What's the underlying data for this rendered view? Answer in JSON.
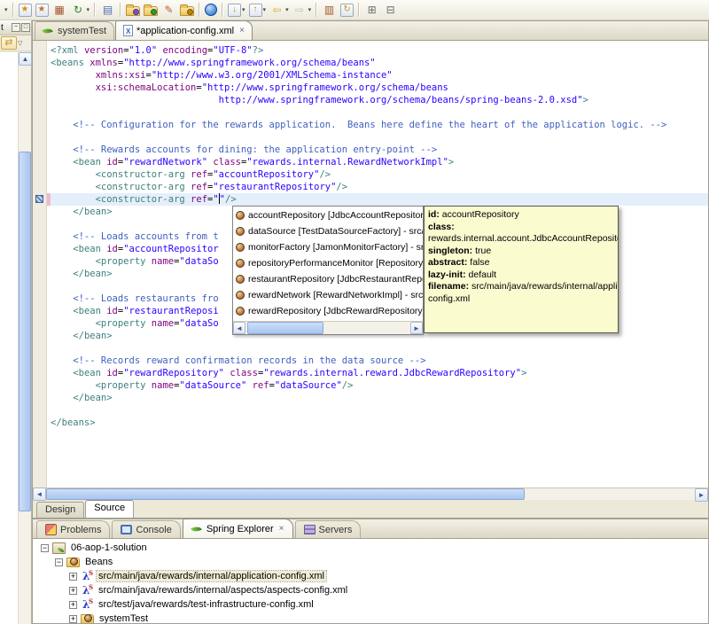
{
  "toolbar": {
    "items": [
      {
        "name": "toolbar-overflow-chevron",
        "kind": "caret-only"
      },
      {
        "sep": true
      },
      {
        "name": "new-wizard-icon",
        "kind": "boxglyph",
        "glyph": "★",
        "fg": "#d89010"
      },
      {
        "name": "new-wizard-alt-icon",
        "kind": "boxglyph",
        "glyph": "★",
        "fg": "#c87020"
      },
      {
        "name": "package-grid-icon",
        "kind": "glyph",
        "glyph": "▦",
        "fg": "#a0522d"
      },
      {
        "name": "refresh-icon",
        "kind": "glyph",
        "glyph": "↻",
        "fg": "#1f8a1f",
        "caret": true
      },
      {
        "sep": true
      },
      {
        "name": "table-wizard-icon",
        "kind": "glyph",
        "glyph": "▤",
        "fg": "#4f6fae"
      },
      {
        "sep": true
      },
      {
        "name": "import-folder-icon",
        "kind": "folder",
        "dot": "#7a4fd0"
      },
      {
        "name": "export-folder-icon",
        "kind": "folder",
        "dot": "#2e9a2e"
      },
      {
        "name": "highlighter-pen-icon",
        "kind": "glyph",
        "glyph": "✎",
        "fg": "#c06030"
      },
      {
        "name": "open-folder-icon",
        "kind": "folder",
        "dot": "#b8860b"
      },
      {
        "sep": true
      },
      {
        "name": "web-browser-icon",
        "kind": "globe"
      },
      {
        "sep": true
      },
      {
        "name": "import-config-icon",
        "kind": "boxglyph",
        "glyph": "↓",
        "fg": "#c89018",
        "caret": true
      },
      {
        "name": "export-config-icon",
        "kind": "boxglyph",
        "glyph": "↑",
        "fg": "#c89018",
        "caret": true
      },
      {
        "name": "back-arrow-icon",
        "kind": "glyph",
        "glyph": "⇦",
        "fg": "#d9a62e",
        "caret": true
      },
      {
        "name": "forward-arrow-icon",
        "kind": "glyph",
        "glyph": "⇨",
        "fg": "#c4c0ae",
        "caret": true
      },
      {
        "sep": true
      },
      {
        "name": "spool-icon",
        "kind": "glyph",
        "glyph": "▥",
        "fg": "#a0522d"
      },
      {
        "name": "refresh-config-icon",
        "kind": "boxglyph",
        "glyph": "↻",
        "fg": "#c89018"
      },
      {
        "sep": true
      },
      {
        "name": "expand-all-icon",
        "kind": "glyph",
        "glyph": "⊞",
        "fg": "#6a6a6a"
      },
      {
        "name": "collapse-all-icon",
        "kind": "glyph",
        "glyph": "⊟",
        "fg": "#6a6a6a"
      }
    ]
  },
  "left_rail": {
    "header_text": "t",
    "minimize_glyph": "−",
    "maximize_glyph": "□",
    "link_glyph": "⇄",
    "dropdown_glyph": "▽",
    "scroll_up_glyph": "▲"
  },
  "editor": {
    "tabs": [
      {
        "name": "tab-systemtest",
        "label": "systemTest",
        "icon": "spring-leaf-icon",
        "selected": false,
        "closable": false
      },
      {
        "name": "tab-application-config",
        "label": "*application-config.xml",
        "icon": "xml-file-icon",
        "selected": true,
        "closable": true,
        "close_glyph": "×"
      }
    ],
    "current_line": 12,
    "code_lines": [
      [
        [
          "<?xml ",
          "g"
        ],
        [
          "version",
          "a"
        ],
        [
          "=",
          "p"
        ],
        [
          "\"1.0\"",
          "v"
        ],
        [
          " ",
          "p"
        ],
        [
          "encoding",
          "a"
        ],
        [
          "=",
          "p"
        ],
        [
          "\"UTF-8\"",
          "v"
        ],
        [
          "?>",
          "g"
        ]
      ],
      [
        [
          "<beans ",
          "g"
        ],
        [
          "xmlns",
          "a"
        ],
        [
          "=",
          "p"
        ],
        [
          "\"http://www.springframework.org/schema/beans\"",
          "v"
        ]
      ],
      [
        [
          "        ",
          "p"
        ],
        [
          "xmlns:xsi",
          "a"
        ],
        [
          "=",
          "p"
        ],
        [
          "\"http://www.w3.org/2001/XMLSchema-instance\"",
          "v"
        ]
      ],
      [
        [
          "        ",
          "p"
        ],
        [
          "xsi:schemaLocation",
          "a"
        ],
        [
          "=",
          "p"
        ],
        [
          "\"http://www.springframework.org/schema/beans",
          "v"
        ]
      ],
      [
        [
          "                              ",
          "p"
        ],
        [
          "http://www.springframework.org/schema/beans/spring-beans-2.0.xsd\"",
          "v"
        ],
        [
          ">",
          "g"
        ]
      ],
      [],
      [
        [
          "    <!-- Configuration for the rewards application.  Beans here define the heart of the application logic. -->",
          "c"
        ]
      ],
      [],
      [
        [
          "    <!-- Rewards accounts for dining: the application entry-point -->",
          "c"
        ]
      ],
      [
        [
          "    ",
          "p"
        ],
        [
          "<bean ",
          "g"
        ],
        [
          "id",
          "a"
        ],
        [
          "=",
          "p"
        ],
        [
          "\"rewardNetwork\"",
          "v"
        ],
        [
          " ",
          "p"
        ],
        [
          "class",
          "a"
        ],
        [
          "=",
          "p"
        ],
        [
          "\"rewards.internal.RewardNetworkImpl\"",
          "v"
        ],
        [
          ">",
          "g"
        ]
      ],
      [
        [
          "        ",
          "p"
        ],
        [
          "<constructor-arg ",
          "g"
        ],
        [
          "ref",
          "a"
        ],
        [
          "=",
          "p"
        ],
        [
          "\"accountRepository\"",
          "v"
        ],
        [
          "/>",
          "g"
        ]
      ],
      [
        [
          "        ",
          "p"
        ],
        [
          "<constructor-arg ",
          "g"
        ],
        [
          "ref",
          "a"
        ],
        [
          "=",
          "p"
        ],
        [
          "\"restaurantRepository\"",
          "v"
        ],
        [
          "/>",
          "g"
        ]
      ],
      [
        [
          "        ",
          "p"
        ],
        [
          "<constructor-arg ",
          "g"
        ],
        [
          "ref",
          "a"
        ],
        [
          "=",
          "p"
        ],
        [
          "\"",
          "v"
        ],
        [
          "",
          "caret"
        ],
        [
          "\"",
          "v"
        ],
        [
          "/>",
          "g"
        ]
      ],
      [
        [
          "    ",
          "p"
        ],
        [
          "</bean>",
          "g"
        ]
      ],
      [],
      [
        [
          "    <!-- Loads accounts from t",
          "c"
        ]
      ],
      [
        [
          "    ",
          "p"
        ],
        [
          "<bean ",
          "g"
        ],
        [
          "id",
          "a"
        ],
        [
          "=",
          "p"
        ],
        [
          "\"accountRepositor",
          "v"
        ]
      ],
      [
        [
          "        ",
          "p"
        ],
        [
          "<property ",
          "g"
        ],
        [
          "name",
          "a"
        ],
        [
          "=",
          "p"
        ],
        [
          "\"dataSo",
          "v"
        ]
      ],
      [
        [
          "    ",
          "p"
        ],
        [
          "</bean>",
          "g"
        ]
      ],
      [],
      [
        [
          "    <!-- Loads restaurants fro",
          "c"
        ]
      ],
      [
        [
          "    ",
          "p"
        ],
        [
          "<bean ",
          "g"
        ],
        [
          "id",
          "a"
        ],
        [
          "=",
          "p"
        ],
        [
          "\"restaurantReposi",
          "v"
        ]
      ],
      [
        [
          "        ",
          "p"
        ],
        [
          "<property ",
          "g"
        ],
        [
          "name",
          "a"
        ],
        [
          "=",
          "p"
        ],
        [
          "\"dataSo",
          "v"
        ]
      ],
      [
        [
          "    ",
          "p"
        ],
        [
          "</bean>",
          "g"
        ]
      ],
      [],
      [
        [
          "    <!-- Records reward confirmation records in the data source -->",
          "c"
        ]
      ],
      [
        [
          "    ",
          "p"
        ],
        [
          "<bean ",
          "g"
        ],
        [
          "id",
          "a"
        ],
        [
          "=",
          "p"
        ],
        [
          "\"rewardRepository\"",
          "v"
        ],
        [
          " ",
          "p"
        ],
        [
          "class",
          "a"
        ],
        [
          "=",
          "p"
        ],
        [
          "\"rewards.internal.reward.JdbcRewardRepository\"",
          "v"
        ],
        [
          ">",
          "g"
        ]
      ],
      [
        [
          "        ",
          "p"
        ],
        [
          "<property ",
          "g"
        ],
        [
          "name",
          "a"
        ],
        [
          "=",
          "p"
        ],
        [
          "\"dataSource\"",
          "v"
        ],
        [
          " ",
          "p"
        ],
        [
          "ref",
          "a"
        ],
        [
          "=",
          "p"
        ],
        [
          "\"dataSource\"",
          "v"
        ],
        [
          "/>",
          "g"
        ]
      ],
      [
        [
          "    ",
          "p"
        ],
        [
          "</bean>",
          "g"
        ]
      ],
      [],
      [
        [
          "</beans>",
          "g"
        ]
      ]
    ],
    "page_tabs": [
      {
        "name": "page-tab-design",
        "label": "Design",
        "selected": false
      },
      {
        "name": "page-tab-source",
        "label": "Source",
        "selected": true
      }
    ]
  },
  "popup": {
    "items": [
      {
        "label": "accountRepository [JdbcAccountRepository] - src"
      },
      {
        "label": "dataSource [TestDataSourceFactory] - src/test/ja"
      },
      {
        "label": "monitorFactory [JamonMonitorFactory] - src/main"
      },
      {
        "label": "repositoryPerformanceMonitor [RepositoryPerfor"
      },
      {
        "label": "restaurantRepository [JdbcRestaurantRepository]"
      },
      {
        "label": "rewardNetwork [RewardNetworkImpl] - src/main/j"
      },
      {
        "label": "rewardRepository [JdbcRewardRepository] - src/r"
      }
    ],
    "scroll_left_glyph": "◄",
    "scroll_right_glyph": "►"
  },
  "tooltip": {
    "lines": [
      [
        [
          "id:",
          "b"
        ],
        [
          " accountRepository",
          "n"
        ]
      ],
      [
        [
          "class:",
          "b"
        ]
      ],
      [
        [
          " rewards.internal.account.JdbcAccountRepository",
          "n"
        ]
      ],
      [
        [
          "singleton:",
          "b"
        ],
        [
          " true",
          "n"
        ]
      ],
      [
        [
          "abstract:",
          "b"
        ],
        [
          " false",
          "n"
        ]
      ],
      [
        [
          "lazy-init:",
          "b"
        ],
        [
          " default",
          "n"
        ]
      ],
      [
        [
          "filename:",
          "b"
        ],
        [
          " src/main/java/rewards/internal/application-",
          "n"
        ]
      ],
      [
        [
          " config.xml",
          "n"
        ]
      ]
    ]
  },
  "bottom": {
    "tabs": [
      {
        "name": "tab-problems",
        "label": "Problems",
        "icon": "problems-icon",
        "selected": false
      },
      {
        "name": "tab-console",
        "label": "Console",
        "icon": "console-icon",
        "selected": false
      },
      {
        "name": "tab-spring-explorer",
        "label": "Spring Explorer",
        "icon": "spring-leaf-icon",
        "selected": true,
        "closable": true,
        "close_glyph": "×"
      },
      {
        "name": "tab-servers",
        "label": "Servers",
        "icon": "servers-icon",
        "selected": false
      }
    ],
    "tree": [
      {
        "depth": 0,
        "exp": "−",
        "icon": "spring-project-icon",
        "label": "06-aop-1-solution",
        "selected": false
      },
      {
        "depth": 1,
        "exp": "−",
        "icon": "beans-folder-icon",
        "label": "Beans",
        "selected": false
      },
      {
        "depth": 2,
        "exp": "+",
        "icon": "bean-config-icon",
        "label": "src/main/java/rewards/internal/application-config.xml",
        "selected": true
      },
      {
        "depth": 2,
        "exp": "+",
        "icon": "bean-config-icon",
        "label": "src/main/java/rewards/internal/aspects/aspects-config.xml",
        "selected": false
      },
      {
        "depth": 2,
        "exp": "+",
        "icon": "bean-config-icon",
        "label": "src/test/java/rewards/test-infrastructure-config.xml",
        "selected": false
      },
      {
        "depth": 2,
        "exp": "+",
        "icon": "beans-folder-icon",
        "label": "systemTest",
        "selected": false
      }
    ]
  }
}
